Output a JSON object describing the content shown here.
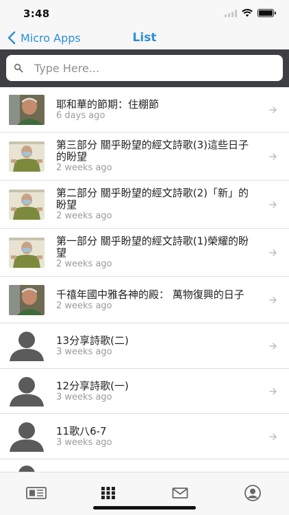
{
  "status_bar": {
    "time": "3:48"
  },
  "nav": {
    "back_label": "Micro Apps",
    "title": "List"
  },
  "search": {
    "placeholder": "Type Here...",
    "value": ""
  },
  "items": [
    {
      "title": "耶和華的節期：住棚節",
      "subtitle": "6 days ago",
      "image": "man-photo"
    },
    {
      "title": "第三部分 關乎盼望的經文詩歌(3)這些日子的盼望",
      "subtitle": "2 weeks ago",
      "image": "man-mask-photo"
    },
    {
      "title": "第二部分 關乎盼望的經文詩歌(2)「新」的盼望",
      "subtitle": "2 weeks ago",
      "image": "man-mask-photo"
    },
    {
      "title": "第一部分 關乎盼望的經文詩歌(1)榮耀的盼望",
      "subtitle": "2 weeks ago",
      "image": "man-mask-photo"
    },
    {
      "title": "千禧年國中雅各神的殿： 萬物復興的日子",
      "subtitle": "2 weeks ago",
      "image": "man-photo"
    },
    {
      "title": "13分享詩歌(二)",
      "subtitle": "3 weeks ago",
      "image": "person-placeholder-icon"
    },
    {
      "title": "12分享詩歌(一)",
      "subtitle": "3 weeks ago",
      "image": "person-placeholder-icon"
    },
    {
      "title": "11歌八6-7",
      "subtitle": "3 weeks ago",
      "image": "person-placeholder-icon"
    }
  ],
  "tabs": [
    "newspaper-icon",
    "grid-icon",
    "mail-icon",
    "profile-icon"
  ],
  "colors": {
    "accent": "#2c8fd6",
    "search_bar_bg": "#3d3f42",
    "subtitle": "#9a9a9a"
  }
}
